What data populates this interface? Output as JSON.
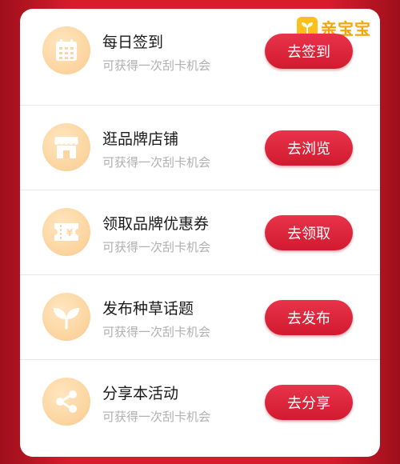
{
  "brand": {
    "name": "亲宝宝",
    "accent": "#ffc01a",
    "icon": "sprout-icon"
  },
  "tasks": [
    {
      "icon": "calendar-icon",
      "title": "每日签到",
      "subtitle": "可获得一次刮卡机会",
      "button": "去签到"
    },
    {
      "icon": "shop-icon",
      "title": "逛品牌店铺",
      "subtitle": "可获得一次刮卡机会",
      "button": "去浏览"
    },
    {
      "icon": "coupon-icon",
      "title": "领取品牌优惠券",
      "subtitle": "可获得一次刮卡机会",
      "button": "去领取"
    },
    {
      "icon": "leaf-icon",
      "title": "发布种草话题",
      "subtitle": "可获得一次刮卡机会",
      "button": "去发布"
    },
    {
      "icon": "share-icon",
      "title": "分享本活动",
      "subtitle": "可获得一次刮卡机会",
      "button": "去分享"
    }
  ],
  "colors": {
    "background": "#d81c2c",
    "button": "#d21a2f",
    "icon_bg": "#fcd6a2"
  }
}
